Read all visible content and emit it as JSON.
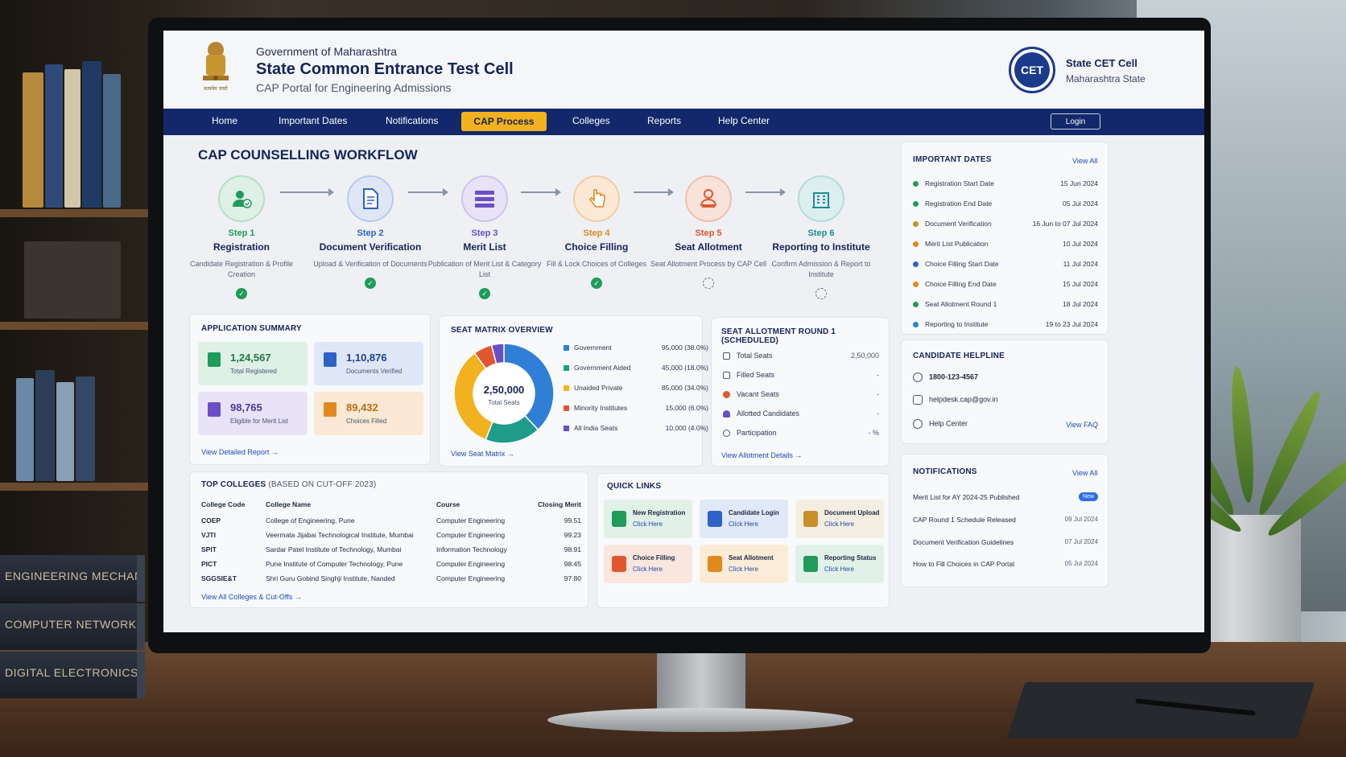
{
  "header": {
    "gov": "Government of Maharashtra",
    "title": "State Common Entrance Test Cell",
    "subtitle": "CAP Portal for Engineering Admissions",
    "emblem_text": "सत्यमेव जयते",
    "logo_text": "CET",
    "brand_name": "State CET Cell",
    "brand_state": "Maharashtra State"
  },
  "nav": {
    "items": [
      "Home",
      "Important Dates",
      "Notifications",
      "CAP Process",
      "Colleges",
      "Reports",
      "Help Center"
    ],
    "active": "CAP Process",
    "login": "Login"
  },
  "workflow": {
    "title": "CAP COUNSELLING WORKFLOW",
    "steps": [
      {
        "no": "Step 1",
        "name": "Registration",
        "desc": "Candidate Registration & Profile Creation",
        "status": "completed",
        "color": "#1f9b5a",
        "icon": "user-check-icon"
      },
      {
        "no": "Step 2",
        "name": "Document Verification",
        "desc": "Upload & Verification of Documents",
        "status": "completed",
        "color": "#2f62c8",
        "icon": "document-icon"
      },
      {
        "no": "Step 3",
        "name": "Merit List",
        "desc": "Publication of Merit List & Category List",
        "status": "completed",
        "color": "#6b4fc6",
        "icon": "list-icon"
      },
      {
        "no": "Step 4",
        "name": "Choice Filling",
        "desc": "Fill & Lock Choices of Colleges",
        "status": "completed",
        "color": "#e08a1e",
        "icon": "hand-pointer-icon"
      },
      {
        "no": "Step 5",
        "name": "Seat Allotment",
        "desc": "Seat Allotment Process by CAP Cell",
        "status": "pending",
        "color": "#e0572f",
        "icon": "seat-user-icon"
      },
      {
        "no": "Step 6",
        "name": "Reporting to Institute",
        "desc": "Confirm Admission & Report to Institute",
        "status": "pending",
        "color": "#1f8a9a",
        "icon": "building-icon"
      }
    ]
  },
  "summary": {
    "title": "APPLICATION SUMMARY",
    "stats": [
      {
        "value": "1,24,567",
        "label": "Total Registered",
        "color": "#1f9b5a",
        "bg": "#dff0e6",
        "icon": "registration-icon"
      },
      {
        "value": "1,10,876",
        "label": "Documents Verified",
        "color": "#2f62c8",
        "bg": "#dfe7f7",
        "icon": "documents-icon"
      },
      {
        "value": "98,765",
        "label": "Eligible for Merit List",
        "color": "#6b4fc6",
        "bg": "#e8e3f6",
        "icon": "merit-list-icon"
      },
      {
        "value": "89,432",
        "label": "Choices Filled",
        "color": "#e08a1e",
        "bg": "#fbe9d5",
        "icon": "choices-icon"
      }
    ],
    "link": "View Detailed Report →"
  },
  "seat_matrix": {
    "title": "SEAT MATRIX OVERVIEW",
    "total_value": "2,50,000",
    "total_label": "Total Seats",
    "categories": [
      {
        "name": "Government",
        "seats": "95,000 (38.0%)",
        "color": "#2f7fd6"
      },
      {
        "name": "Government Aided",
        "seats": "45,000 (18.0%)",
        "color": "#1f9b8a"
      },
      {
        "name": "Unaided Private",
        "seats": "85,000 (34.0%)",
        "color": "#f2b11e"
      },
      {
        "name": "Minority Institutes",
        "seats": "15,000 (6.0%)",
        "color": "#e0572f"
      },
      {
        "name": "All India Seats",
        "seats": "10,000 (4.0%)",
        "color": "#6b4fc6"
      }
    ],
    "link": "View Seat Matrix →"
  },
  "chart_data": {
    "type": "pie",
    "title": "SEAT MATRIX OVERVIEW",
    "categories": [
      "Government",
      "Government Aided",
      "Unaided Private",
      "Minority Institutes",
      "All India Seats"
    ],
    "values": [
      95000,
      45000,
      85000,
      15000,
      10000
    ],
    "colors": [
      "#2f7fd6",
      "#1f9b8a",
      "#f2b11e",
      "#e0572f",
      "#6b4fc6"
    ],
    "center_value": "2,50,000",
    "center_label": "Total Seats",
    "legend": "right"
  },
  "allotment": {
    "title": "SEAT ALLOTMENT ROUND 1 (SCHEDULED)",
    "rows": [
      {
        "label": "Total Seats",
        "value": "2,50,000",
        "icon": "seats-icon"
      },
      {
        "label": "Filled Seats",
        "value": "-",
        "icon": "filled-icon"
      },
      {
        "label": "Vacant Seats",
        "value": "-",
        "icon": "vacant-icon"
      },
      {
        "label": "Allotted Candidates",
        "value": "-",
        "icon": "candidates-icon"
      },
      {
        "label": "Participation",
        "value": "- %",
        "icon": "participation-icon"
      }
    ],
    "link": "View Allotment Details →"
  },
  "colleges": {
    "title": "TOP COLLEGES",
    "title_note": "(BASED ON CUT-OFF 2023)",
    "headers": [
      "College Code",
      "College Name",
      "Course",
      "Closing Merit"
    ],
    "rows": [
      [
        "COEP",
        "College of Engineering, Pune",
        "Computer Engineering",
        "99.51"
      ],
      [
        "VJTI",
        "Veermata Jijabai Technological Institute, Mumbai",
        "Computer Engineering",
        "99.23"
      ],
      [
        "SPIT",
        "Sardar Patel Institute of Technology, Mumbai",
        "Information Technology",
        "98.91"
      ],
      [
        "PICT",
        "Pune Institute of Computer Technology, Pune",
        "Computer Engineering",
        "98.45"
      ],
      [
        "SGGSIE&T",
        "Shri Guru Gobind Singhji Institute, Nanded",
        "Computer Engineering",
        "97.80"
      ]
    ],
    "link": "View All Colleges & Cut-Offs →"
  },
  "quick_links": {
    "title": "QUICK LINKS",
    "items": [
      {
        "name": "New Registration",
        "action": "Click Here",
        "color": "#1f9b5a",
        "bg": "#e2f1e8",
        "icon": "new-registration-icon"
      },
      {
        "name": "Candidate Login",
        "action": "Click Here",
        "color": "#2f62c8",
        "bg": "#e1e8f7",
        "icon": "candidate-login-icon"
      },
      {
        "name": "Document Upload",
        "action": "Click Here",
        "color": "#c8902a",
        "bg": "#f3eee2",
        "icon": "document-upload-icon"
      },
      {
        "name": "Choice Filling",
        "action": "Click Here",
        "color": "#e0572f",
        "bg": "#f8e6df",
        "icon": "choice-filling-icon"
      },
      {
        "name": "Seat Allotment",
        "action": "Click Here",
        "color": "#e08a1e",
        "bg": "#fbecd8",
        "icon": "seat-allotment-icon"
      },
      {
        "name": "Reporting Status",
        "action": "Click Here",
        "color": "#1f9b5a",
        "bg": "#e2f1e8",
        "icon": "reporting-status-icon"
      }
    ]
  },
  "important_dates": {
    "title": "IMPORTANT DATES",
    "view_all": "View All",
    "rows": [
      {
        "label": "Registration Start Date",
        "date": "15 Jun 2024",
        "color": "#1f9b5a"
      },
      {
        "label": "Registration End Date",
        "date": "05 Jul 2024",
        "color": "#1f9b5a"
      },
      {
        "label": "Document Verification",
        "date": "16 Jun to 07 Jul 2024",
        "color": "#c8902a"
      },
      {
        "label": "Merit List Publication",
        "date": "10 Jul 2024",
        "color": "#e08a1e"
      },
      {
        "label": "Choice Filling Start Date",
        "date": "11 Jul 2024",
        "color": "#2f62c8"
      },
      {
        "label": "Choice Filling End Date",
        "date": "15 Jul 2024",
        "color": "#e08a1e"
      },
      {
        "label": "Seat Allotment Round 1",
        "date": "18 Jul 2024",
        "color": "#1f9b5a"
      },
      {
        "label": "Reporting to Institute",
        "date": "19 to 23 Jul 2024",
        "color": "#2f7fd6"
      }
    ]
  },
  "helpline": {
    "title": "CANDIDATE HELPLINE",
    "phone": "1800-123-4567",
    "email": "helpdesk.cap@gov.in",
    "help_center": "Help Center",
    "faq": "View FAQ"
  },
  "notifications": {
    "title": "NOTIFICATIONS",
    "view_all": "View All",
    "rows": [
      {
        "text": "Merit List for AY 2024-25 Published",
        "date": "",
        "badge": "New"
      },
      {
        "text": "CAP Round 1 Schedule Released",
        "date": "09 Jul 2024",
        "badge": ""
      },
      {
        "text": "Document Verification Guidelines",
        "date": "07 Jul 2024",
        "badge": ""
      },
      {
        "text": "How to Fill Choices in CAP Portal",
        "date": "05 Jul 2024",
        "badge": ""
      }
    ]
  },
  "desk_books": [
    "ENGINEERING MECHANICS",
    "COMPUTER NETWORKS",
    "DIGITAL ELECTRONICS"
  ]
}
